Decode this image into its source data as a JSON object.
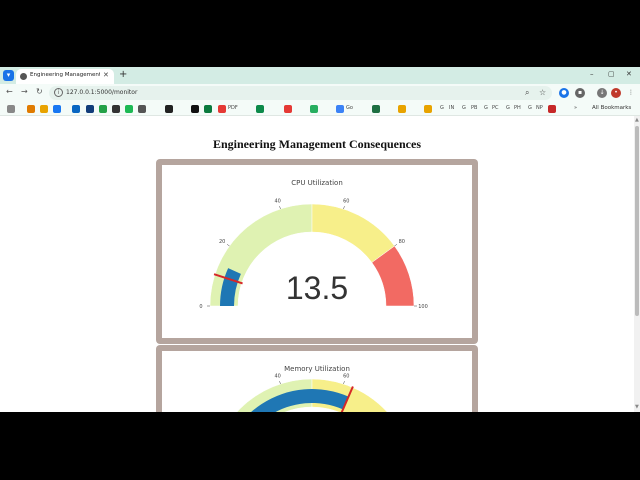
{
  "browser": {
    "tab_title": "Engineering Management Con",
    "url": "127.0.0.1:5000/monitor",
    "bookmarks": [
      "PDF",
      "Go",
      "G",
      "IN",
      "G",
      "PB",
      "G",
      "PC",
      "G",
      "PH",
      "G",
      "NP"
    ],
    "all_bookmarks_label": "All Bookmarks"
  },
  "page": {
    "title": "Engineering Management Consequences"
  },
  "gauges": [
    {
      "title": "CPU Utilization",
      "value": "13.5",
      "numeric": 13.5,
      "threshold": 10,
      "bar_color": "#1f77b4",
      "ticks": [
        "0",
        "20",
        "40",
        "60",
        "80",
        "100"
      ]
    },
    {
      "title": "Memory Utilization",
      "value": "",
      "numeric": 63,
      "threshold": 63,
      "bar_color": "#1f77b4",
      "ticks": [
        "40",
        "60"
      ]
    }
  ],
  "ranges": {
    "low_color": "#dff2b2",
    "mid_color": "#f7ef8a",
    "high_color": "#f26a63",
    "bands": [
      [
        0,
        50
      ],
      [
        50,
        80
      ],
      [
        80,
        100
      ]
    ]
  }
}
